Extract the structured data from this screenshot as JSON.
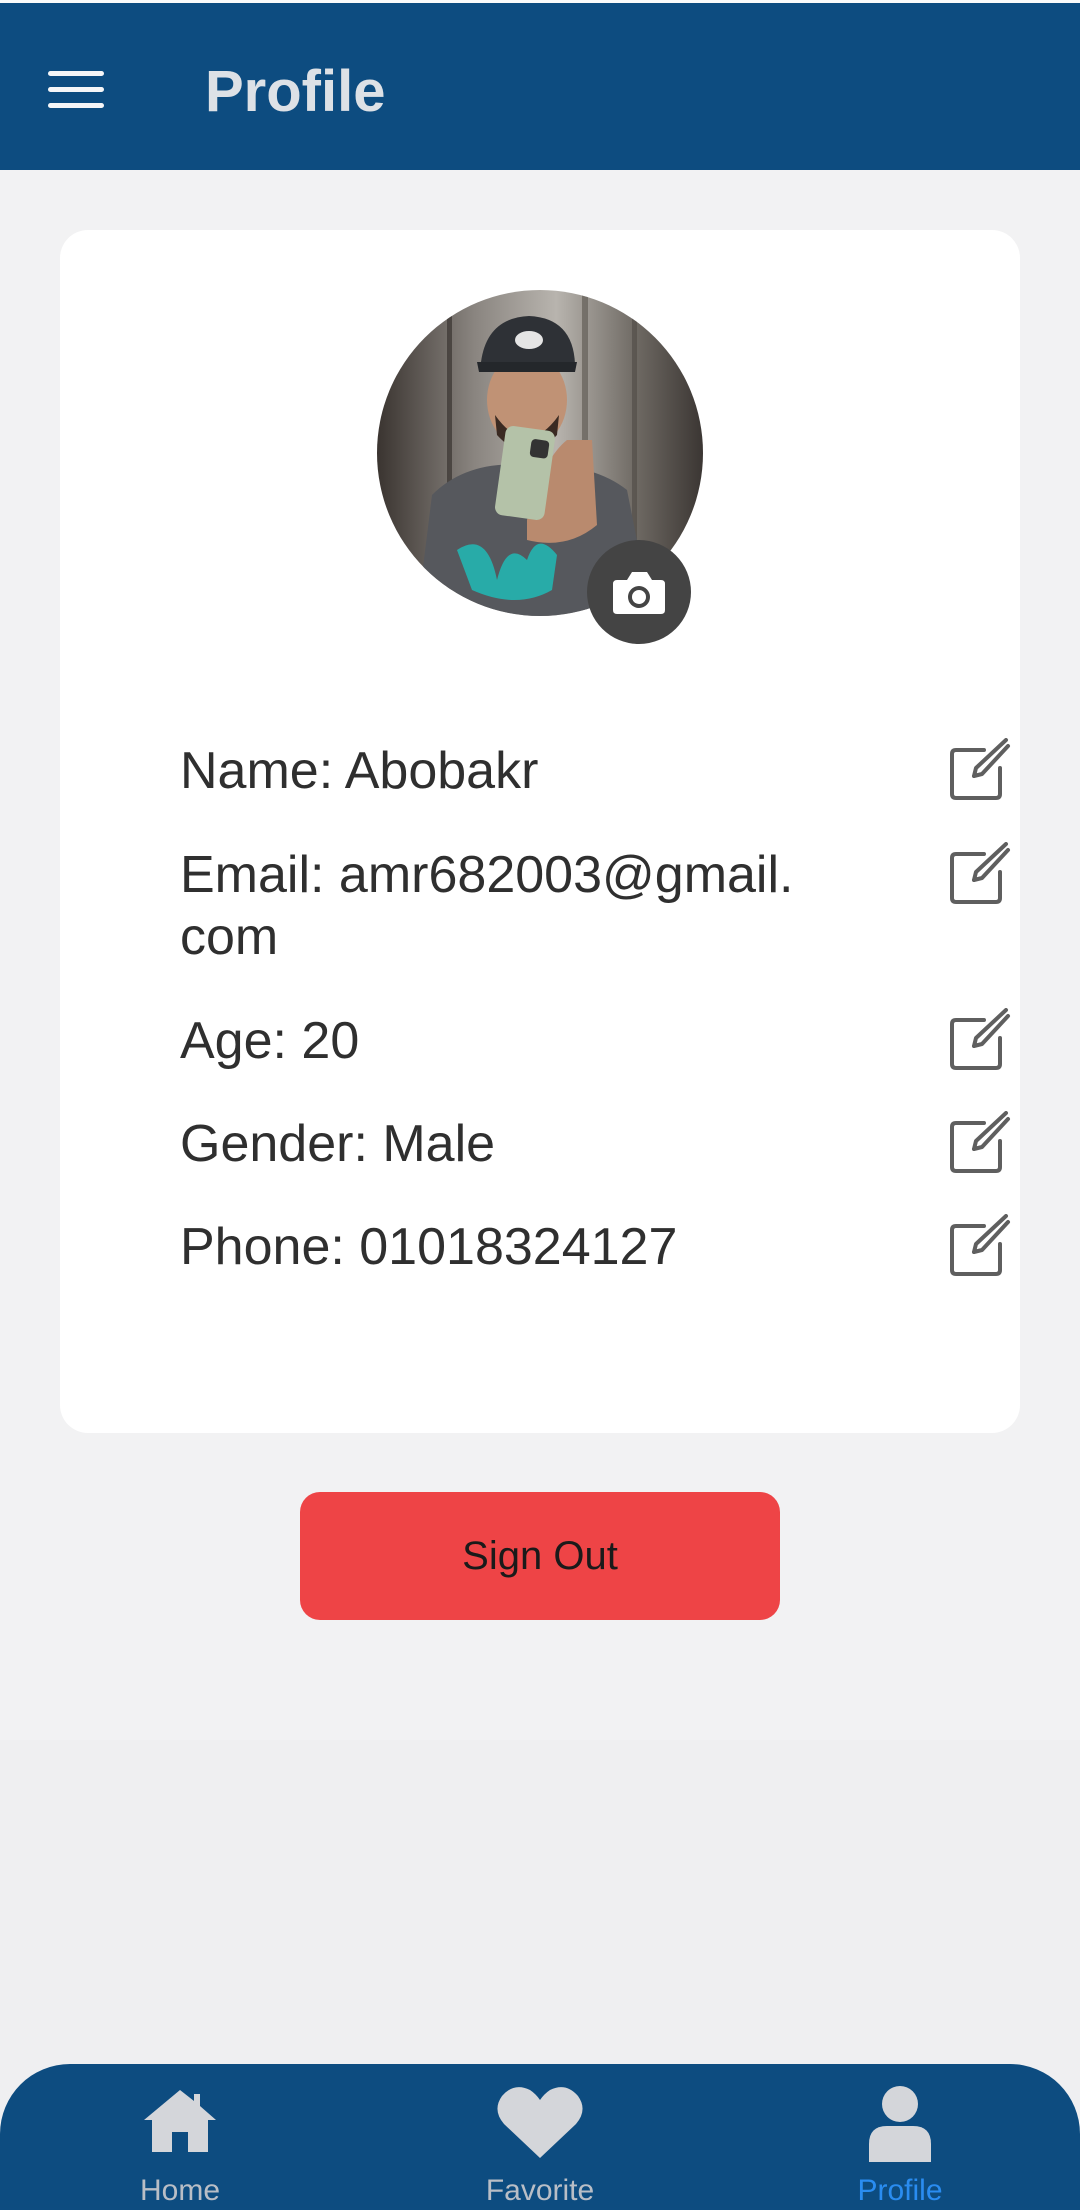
{
  "header": {
    "title": "Profile",
    "menu_icon": "hamburger-menu-icon"
  },
  "profile": {
    "avatar_alt": "profile photo",
    "camera_icon": "camera-icon",
    "fields": [
      {
        "key": "name",
        "text": "Name: Abobakr"
      },
      {
        "key": "email",
        "text": "Email: amr682003@gmail.com"
      },
      {
        "key": "age",
        "text": "Age: 20"
      },
      {
        "key": "gender",
        "text": "Gender: Male"
      },
      {
        "key": "phone",
        "text": "Phone: 01018324127"
      }
    ],
    "edit_icon": "edit-icon"
  },
  "actions": {
    "sign_out_label": "Sign Out"
  },
  "bottom_nav": {
    "items": [
      {
        "label": "Home",
        "icon": "home-icon",
        "active": false
      },
      {
        "label": "Favorite",
        "icon": "heart-icon",
        "active": false
      },
      {
        "label": "Profile",
        "icon": "user-icon",
        "active": true
      }
    ]
  },
  "colors": {
    "primary": "#0d4c80",
    "danger": "#ee4446",
    "active_nav": "#2a8cf0",
    "background": "#f2f2f3"
  }
}
